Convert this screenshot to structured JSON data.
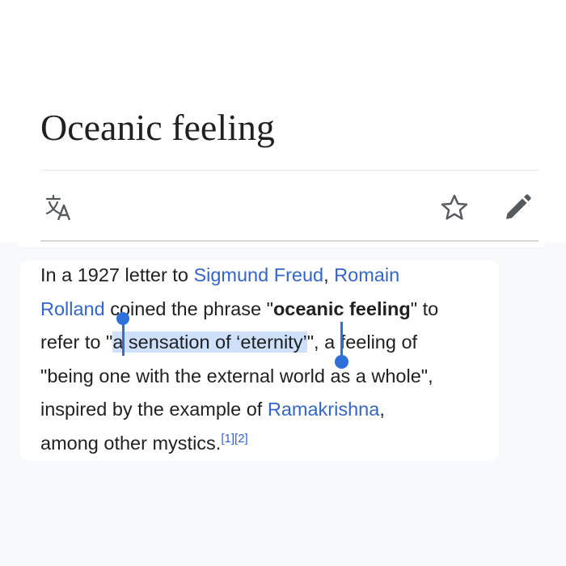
{
  "article": {
    "title": "Oceanic feeling"
  },
  "toolbar": {
    "icons": [
      "language-icon",
      "star-icon",
      "edit-icon"
    ],
    "icon_color": "#54595d"
  },
  "colors": {
    "text": "#202122",
    "link": "#3366cc",
    "selection_highlight": "#cfe0fb",
    "selection_handle": "#2f6fd9"
  },
  "paragraph": {
    "line1_prefix": "In a 1927 letter to ",
    "link_freud": "Sigmund Freud",
    "line1_comma": ", ",
    "link_romain": "Romain",
    "link_rolland": "Rolland",
    "line2_text": " coined the phrase \"",
    "bold_phrase": "oceanic feeling",
    "line2_suffix": "\" to",
    "line3_prefix": "refer to \"",
    "selected_text": "a sensation of ‘eternity’",
    "line3_suffix": "\", a feeling of",
    "line4": "\"being one with the external world as a whole\",",
    "line5_prefix": "inspired by the example of ",
    "link_ramakrishna": "Ramakrishna",
    "line5_suffix": ",",
    "line6": "among other mystics.",
    "ref1": "[1]",
    "ref2": "[2]"
  }
}
